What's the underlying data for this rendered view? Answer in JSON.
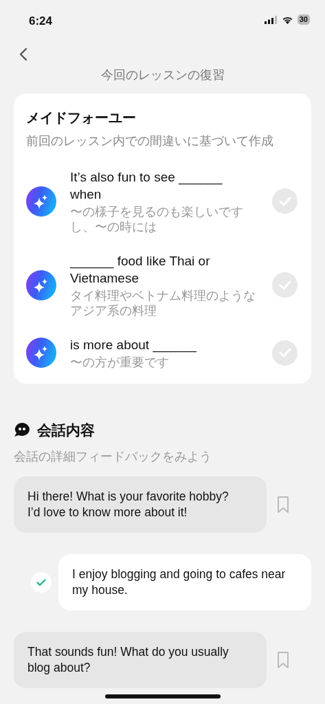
{
  "status_bar": {
    "time": "6:24",
    "battery": "30"
  },
  "header": {
    "title": "今回のレッスンの復習"
  },
  "made_for_you": {
    "title": "メイドフォーユー",
    "subtitle": "前回のレッスン内での間違いに基づいて作成",
    "items": [
      {
        "phrase": "It’s also fun to see ______ when",
        "translation": "〜の様子を見るのも楽しいですし、〜の時には",
        "checked": false
      },
      {
        "phrase": "______ food like Thai or Vietnamese",
        "translation": "タイ料理やベトナム料理のようなアジア系の料理",
        "checked": false
      },
      {
        "phrase": "is more about ______",
        "translation": "〜の方が重要です",
        "checked": false
      }
    ]
  },
  "conversation": {
    "title": "会話内容",
    "subtitle": "会話の詳細フィードバックをみよう",
    "messages": [
      {
        "kind": "ai",
        "text": "Hi there! What is your favorite hobby? I’d love to know more about it!",
        "bookmarked": false
      },
      {
        "kind": "user",
        "text": "I enjoy blogging and going to cafes near my house.",
        "correct": true
      },
      {
        "kind": "ai",
        "text": "That sounds fun! What do you usually blog about?",
        "bookmarked": false
      }
    ]
  }
}
